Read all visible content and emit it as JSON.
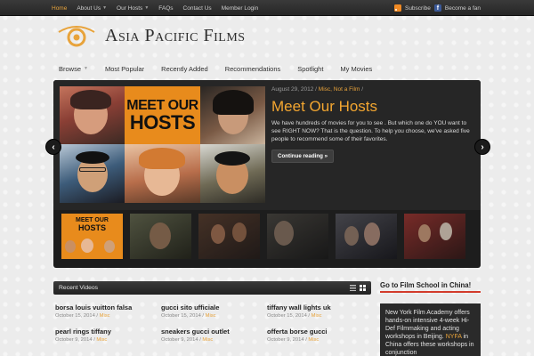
{
  "topbar": {
    "nav": [
      {
        "label": "Home",
        "active": true,
        "has_dropdown": false
      },
      {
        "label": "About Us",
        "active": false,
        "has_dropdown": true
      },
      {
        "label": "Our Hosts",
        "active": false,
        "has_dropdown": true
      },
      {
        "label": "FAQs",
        "active": false,
        "has_dropdown": false
      },
      {
        "label": "Contact Us",
        "active": false,
        "has_dropdown": false
      },
      {
        "label": "Member Login",
        "active": false,
        "has_dropdown": false
      }
    ],
    "subscribe_label": "Subscribe",
    "fan_label": "Become a fan"
  },
  "logo": {
    "text": "Asia Pacific Films"
  },
  "main_nav": [
    {
      "label": "Browse",
      "has_dropdown": true
    },
    {
      "label": "Most Popular",
      "has_dropdown": false
    },
    {
      "label": "Recently Added",
      "has_dropdown": false
    },
    {
      "label": "Recommendations",
      "has_dropdown": false
    },
    {
      "label": "Spotlight",
      "has_dropdown": false
    },
    {
      "label": "My Movies",
      "has_dropdown": false
    }
  ],
  "slider": {
    "date": "August 29, 2012",
    "separator": "/",
    "categories": "Misc, Not a Film",
    "title": "Meet Our Hosts",
    "excerpt": "We have hundreds of movies for you to see . But which one do YOU want to see RIGHT NOW? That is the question. To help you choose, we've asked five people to recommend some of their favorites.",
    "button_label": "Continue reading »",
    "collage_caption_line1": "MEET OUR",
    "collage_caption_line2": "HOSTS",
    "thumb_caption_line1": "MEET OUR",
    "thumb_caption_line2": "HOSTS",
    "prev_label": "‹",
    "next_label": "›"
  },
  "recent_videos": {
    "heading": "Recent Videos",
    "items": [
      {
        "title": "borsa louis vuitton falsa",
        "date": "October 15, 2014",
        "category": "Misc"
      },
      {
        "title": "gucci sito ufficiale",
        "date": "October 15, 2014",
        "category": "Misc"
      },
      {
        "title": "tiffany wall lights uk",
        "date": "October 15, 2014",
        "category": "Misc"
      },
      {
        "title": "pearl rings tiffany",
        "date": "October 9, 2014",
        "category": "Misc"
      },
      {
        "title": "sneakers gucci outlet",
        "date": "October 9, 2014",
        "category": "Misc"
      },
      {
        "title": "offerta borse gucci",
        "date": "October 9, 2014",
        "category": "Misc"
      }
    ]
  },
  "widget": {
    "title": "Go to Film School in China!",
    "body_part1": "New York Film Academy offers hands-on intensive 4-week Hi-Def Filmmaking and acting workshops in Beijing.",
    "body_highlight": "NYFA",
    "body_part2": "in China offers these workshops in conjunction"
  },
  "colors": {
    "accent": "#e8a33b",
    "topbar": "#2e2e2e",
    "widget_underline": "#d23b2b"
  }
}
